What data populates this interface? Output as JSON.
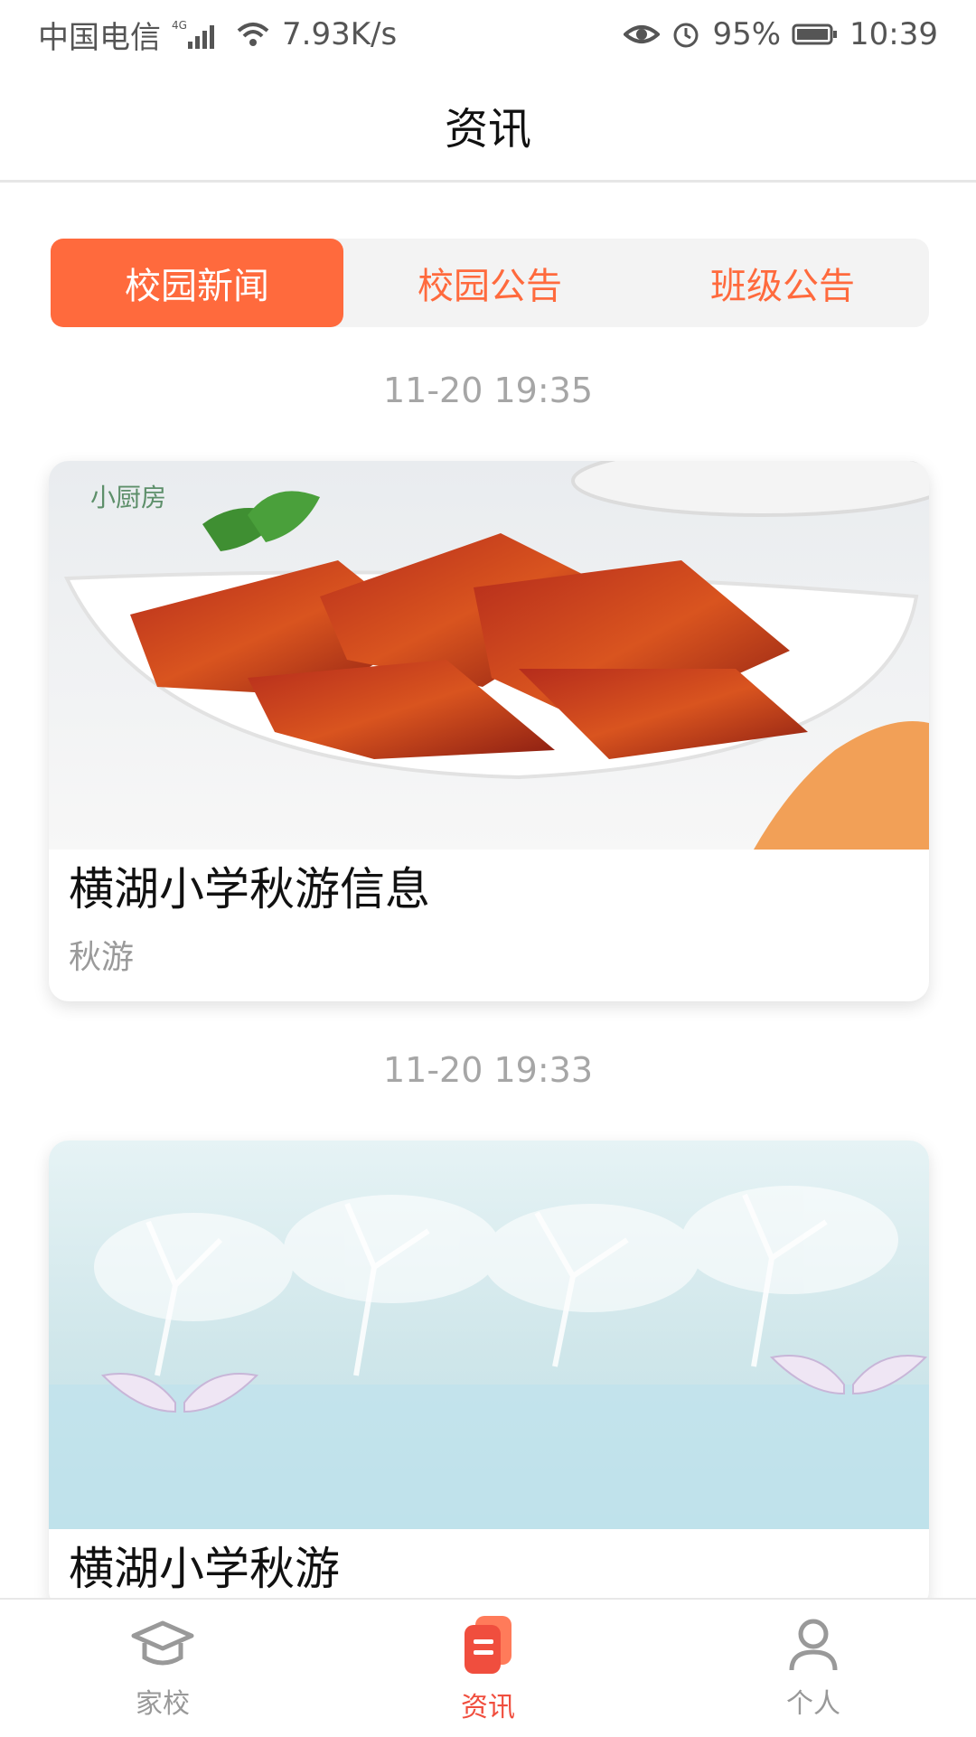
{
  "status_bar": {
    "carrier": "中国电信",
    "network": "4G",
    "speed": "7.93K/s",
    "battery": "95%",
    "time": "10:39"
  },
  "header": {
    "title": "资讯"
  },
  "tabs": [
    {
      "label": "校园新闻",
      "active": true
    },
    {
      "label": "校园公告",
      "active": false
    },
    {
      "label": "班级公告",
      "active": false
    }
  ],
  "feed": [
    {
      "timestamp": "11-20 19:35",
      "title": "横湖小学秋游信息",
      "subtitle": "秋游",
      "image_label": "小厨房"
    },
    {
      "timestamp": "11-20 19:33",
      "title": "横湖小学秋游",
      "subtitle": ""
    }
  ],
  "bottom_nav": [
    {
      "label": "家校",
      "icon": "graduation-cap-icon",
      "active": false
    },
    {
      "label": "资讯",
      "icon": "news-icon",
      "active": true
    },
    {
      "label": "个人",
      "icon": "person-icon",
      "active": false
    }
  ],
  "colors": {
    "accent": "#ff6a3d",
    "nav_active": "#f04e3e",
    "muted_text": "#a6a6a6"
  }
}
